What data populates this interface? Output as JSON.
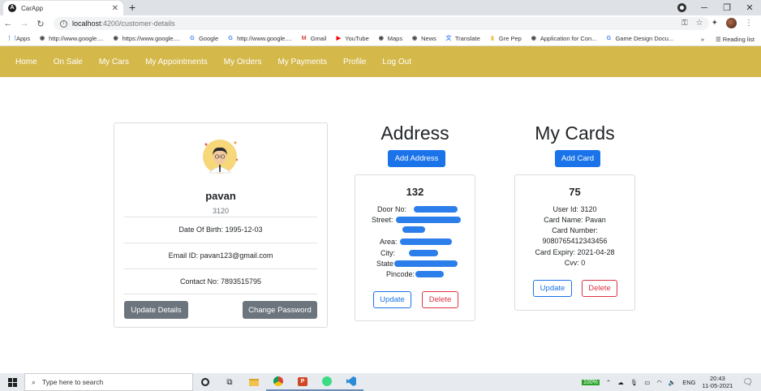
{
  "browser": {
    "tab_title": "CarApp",
    "tab_favicon": "angular-icon",
    "url_host": "localhost",
    "url_path": ":4200/customer-details"
  },
  "bookmarks": {
    "items": [
      {
        "label": "Apps",
        "icon": "apps-grid-icon"
      },
      {
        "label": "http://www.google....",
        "icon": "globe-icon"
      },
      {
        "label": "https://www.google....",
        "icon": "globe-icon"
      },
      {
        "label": "Google",
        "icon": "google-icon"
      },
      {
        "label": "http://www.google....",
        "icon": "google-icon"
      },
      {
        "label": "Gmail",
        "icon": "gmail-icon"
      },
      {
        "label": "YouTube",
        "icon": "youtube-icon"
      },
      {
        "label": "Maps",
        "icon": "globe-icon"
      },
      {
        "label": "News",
        "icon": "globe-icon"
      },
      {
        "label": "Translate",
        "icon": "translate-icon"
      },
      {
        "label": "Gre Pep",
        "icon": "folder-icon"
      },
      {
        "label": "Application for Con...",
        "icon": "globe-icon"
      },
      {
        "label": "Game Design Docu...",
        "icon": "google-icon"
      }
    ],
    "more": "»",
    "reading_list": "Reading list"
  },
  "nav": {
    "links": [
      "Home",
      "On Sale",
      "My Cars",
      "My Appointments",
      "My Orders",
      "My Payments",
      "Profile",
      "Log Out"
    ]
  },
  "profile": {
    "name": "pavan",
    "id": "3120",
    "dob": "Date Of Birth: 1995-12-03",
    "email": "Email ID: pavan123@gmail.com",
    "contact": "Contact No: 7893515795",
    "update_btn": "Update Details",
    "password_btn": "Change Password"
  },
  "address": {
    "title": "Address",
    "add_btn": "Add Address",
    "number": "132",
    "fields": [
      "Door No:",
      "Street:",
      "Area:",
      "City:",
      "State",
      "Pincode:"
    ],
    "update_btn": "Update",
    "delete_btn": "Delete"
  },
  "cards": {
    "title": "My Cards",
    "add_btn": "Add Card",
    "number": "75",
    "user_id": "User Id: 3120",
    "card_name": "Card Name: Pavan",
    "card_number_label": "Card Number:",
    "card_number": "9080765412343456",
    "expiry": "Card Expiry: 2021-04-28",
    "cvv": "Cvv: 0",
    "update_btn": "Update",
    "delete_btn": "Delete"
  },
  "taskbar": {
    "search_placeholder": "Type here to search",
    "battery": "100%",
    "lang": "ENG",
    "time": "20:43",
    "date": "11-05-2021"
  },
  "colors": {
    "navbar": "#d4b84a",
    "primary": "#1a73e8",
    "secondary": "#6c757d",
    "danger": "#dc3545"
  }
}
